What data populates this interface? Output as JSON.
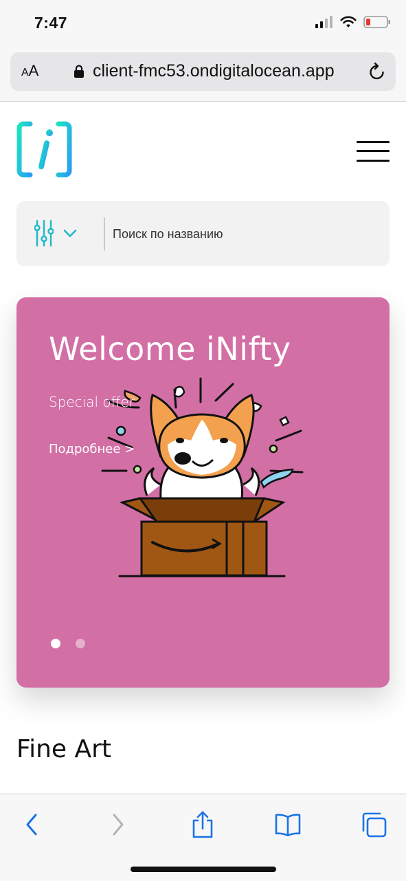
{
  "status_bar": {
    "time": "7:47"
  },
  "browser": {
    "text_size_label_small": "A",
    "text_size_label_large": "A",
    "url": "client-fmc53.ondigitalocean.app"
  },
  "search": {
    "placeholder": "Поиск по названию"
  },
  "banner": {
    "title": "Welcome iNifty",
    "subtitle": "Special offer",
    "link_label": "Подробнее >",
    "background_color": "#d26fa5",
    "slide_count": 2,
    "active_slide": 1
  },
  "section": {
    "title": "Fine Art"
  },
  "colors": {
    "accent": "#1fb8c8",
    "ios_blue": "#1a73e8"
  },
  "icons": {
    "logo": "inifty-logo",
    "menu": "hamburger-menu-icon",
    "filter": "sliders-icon",
    "toolbar": [
      "back-icon",
      "forward-icon",
      "share-icon",
      "bookmarks-icon",
      "tabs-icon"
    ]
  }
}
